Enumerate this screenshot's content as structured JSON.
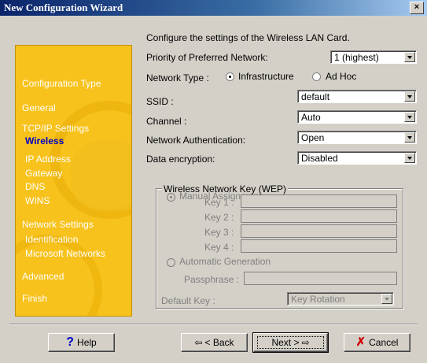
{
  "window": {
    "title": "New Configuration Wizard",
    "close_glyph": "×"
  },
  "header": {
    "description": "Configure the settings of the Wireless LAN Card."
  },
  "sidebar": {
    "items": {
      "configuration_type": "Configuration Type",
      "general": "General",
      "tcpip_settings": "TCP/IP Settings",
      "wireless": "Wireless",
      "ip_address": "IP Address",
      "gateway": "Gateway",
      "dns": "DNS",
      "wins": "WINS",
      "network_settings": "Network Settings",
      "identification": "Identification",
      "microsoft_networks": "Microsoft Networks",
      "advanced": "Advanced",
      "finish": "Finish"
    },
    "active": "Wireless"
  },
  "form": {
    "priority_label": "Priority of Preferred Network:",
    "priority_value": "1 (highest)",
    "network_type_label": "Network Type :",
    "infrastructure_label": "Infrastructure",
    "adhoc_label": "Ad Hoc",
    "network_type_selected": "Infrastructure",
    "ssid_label": "SSID :",
    "ssid_value": "default",
    "channel_label": "Channel :",
    "channel_value": "Auto",
    "auth_label": "Network Authentication:",
    "auth_value": "Open",
    "encryption_label": "Data encryption:",
    "encryption_value": "Disabled"
  },
  "wep": {
    "group_title": "Wireless Network Key (WEP)",
    "manual_label": "Manual Assignment",
    "key1_label": "Key 1 :",
    "key2_label": "Key 2 :",
    "key3_label": "Key 3 :",
    "key4_label": "Key 4 :",
    "auto_label": "Automatic Generation",
    "passphrase_label": "Passphrase :",
    "default_key_label": "Default Key :",
    "default_key_value": "Key Rotation"
  },
  "buttons": {
    "help": "Help",
    "back": "< Back",
    "next": "Next >",
    "cancel": "Cancel",
    "help_icon": "question-mark-icon",
    "back_icon": "left-arrow-icon",
    "next_icon": "right-arrow-icon",
    "cancel_icon": "red-x-icon"
  },
  "colors": {
    "sidebar_bg": "#f7c21c",
    "active_item": "#0000c0",
    "title_bar": "#0a246a"
  }
}
